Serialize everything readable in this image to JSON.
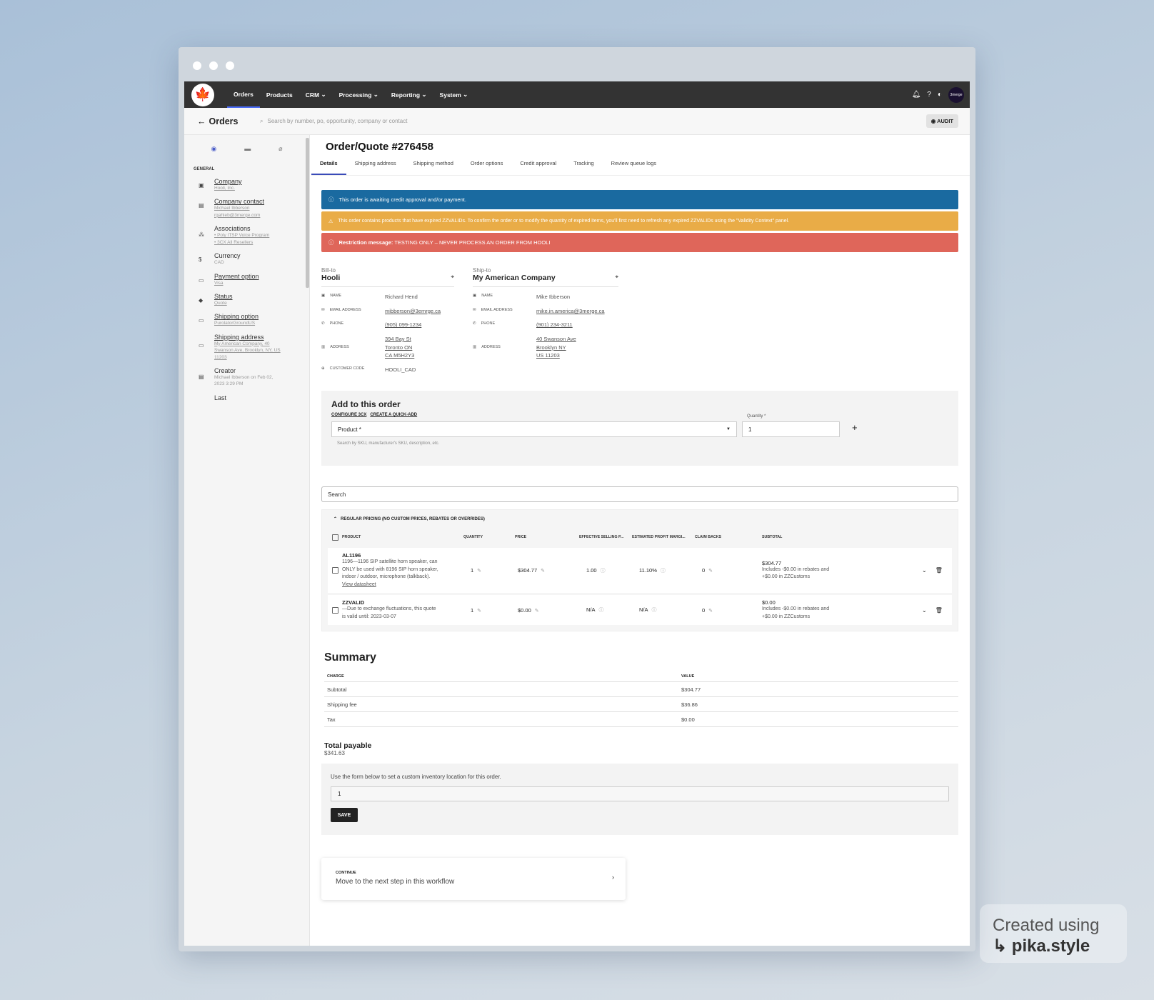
{
  "nav": {
    "items": [
      "Orders",
      "Products",
      "CRM",
      "Processing",
      "Reporting",
      "System"
    ],
    "avatar": "3merge"
  },
  "subbar": {
    "back": "Orders",
    "search_placeholder": "Search by number, po, opportunity, company or contact",
    "audit": "AUDIT"
  },
  "sidebar": {
    "heading": "GENERAL",
    "items": [
      {
        "label": "Company",
        "value": "Hooli, Inc.",
        "icon": "company-icon",
        "link": true
      },
      {
        "label": "Company contact",
        "value": "Michael Ibberson",
        "value2": "rgahleb@3merge.com",
        "icon": "contact-icon",
        "link": true
      },
      {
        "label": "Associations",
        "value": "• Poly ITSP Voice Program",
        "value2": "• 3CX All Resellers",
        "icon": "associations-icon",
        "link": false
      },
      {
        "label": "Currency",
        "value": "CAD",
        "icon": "currency-icon",
        "link": false
      },
      {
        "label": "Payment option",
        "value": "Visa",
        "icon": "payment-icon",
        "link": true
      },
      {
        "label": "Status",
        "value": "Quote",
        "icon": "status-icon",
        "link": true
      },
      {
        "label": "Shipping option",
        "value": "PurolatorGroundUS",
        "icon": "shipping-icon",
        "link": true
      },
      {
        "label": "Shipping address",
        "value": "My American Company, 40",
        "value2": "Swanson Ave, Brooklyn, NY, US",
        "value3": "11203",
        "icon": "address-icon",
        "link": true
      },
      {
        "label": "Creator",
        "value": "Michael Ibberson on Feb 02,",
        "value2": "2023 3:29 PM",
        "icon": "creator-icon",
        "link": false
      },
      {
        "label": "Last",
        "value": "",
        "icon": "",
        "link": false
      }
    ]
  },
  "main": {
    "title": "Order/Quote #276458",
    "tabs": [
      "Details",
      "Shipping address",
      "Shipping method",
      "Order options",
      "Credit approval",
      "Tracking",
      "Review queue logs"
    ],
    "alerts": {
      "info": "This order is awaiting credit approval and/or payment.",
      "warning": "This order contains products that have expired ZZVALIDs. To confirm the order or to modify the quantity of expired items, you'll first need to refresh any expired ZZVALIDs using the \"Validity Context\" panel.",
      "error_label": "Restriction message:",
      "error": "TESTING ONLY – NEVER PROCESS AN ORDER FROM HOOLI"
    },
    "bill_to": {
      "heading": "Bill-to",
      "name": "Hooli",
      "labels": {
        "name": "NAME",
        "email": "EMAIL ADDRESS",
        "phone": "PHONE",
        "address": "ADDRESS",
        "code": "CUSTOMER CODE"
      },
      "contact": "Richard Hend",
      "email": "mibberson@3emrge.ca",
      "phone": "(905) 099-1234",
      "addr1": "394 Bay St",
      "addr2": "Toronto ON",
      "addr3": "CA M5H2Y3",
      "code": "HOOLI_CAD"
    },
    "ship_to": {
      "heading": "Ship-to",
      "name": "My American Company",
      "contact": "Mike Ibberson",
      "email": "mike.in.america@3merge.ca",
      "phone": "(901) 234-3211",
      "addr1": "40 Swanson Ave",
      "addr2": "Brooklyn NY",
      "addr3": "US 11203"
    },
    "add": {
      "heading": "Add to this order",
      "link1": "CONFIGURE 3CX",
      "link2": "CREATE A QUICK-ADD",
      "product_placeholder": "Product *",
      "qty_label": "Quantity *",
      "qty_value": "1",
      "hint": "Search by SKU, manufacturer's SKU, description, etc."
    },
    "table": {
      "search": "Search",
      "group": "REGULAR PRICING (NO CUSTOM PRICES, REBATES OR OVERRIDES)",
      "headers": [
        "PRODUCT",
        "QUANTITY",
        "PRICE",
        "EFFECTIVE SELLING P...",
        "ESTIMATED PROFIT MARGI...",
        "CLAIM BACKS",
        "SUBTOTAL"
      ],
      "rows": [
        {
          "sku": "AL1196",
          "d1": "1196—1196 SIP satellite horn speaker, can",
          "d2": "ONLY be used with 8196 SIP horn speaker,",
          "d3": "indoor / outdoor, microphone (talkback).",
          "link": "View datasheet",
          "qty": "1",
          "price": "$304.77",
          "esp": "1.00",
          "margin": "11.10%",
          "claim": "0",
          "sub": "$304.77",
          "s1": "Includes -$0.00 in rebates and",
          "s2": "+$0.00 in ZZCustoms"
        },
        {
          "sku": "ZZVALID",
          "d1": "—Due to exchange fluctuations, this quote",
          "d2": "is valid until: 2023-03-07",
          "d3": "",
          "link": "",
          "qty": "1",
          "price": "$0.00",
          "esp": "N/A",
          "margin": "N/A",
          "claim": "0",
          "sub": "$0.00",
          "s1": "Includes -$0.00 in rebates and",
          "s2": "+$0.00 in ZZCustoms"
        }
      ]
    },
    "summary": {
      "heading": "Summary",
      "col_charge": "CHARGE",
      "col_value": "VALUE",
      "rows": [
        {
          "charge": "Subtotal",
          "value": "$304.77"
        },
        {
          "charge": "Shipping fee",
          "value": "$36.86"
        },
        {
          "charge": "Tax",
          "value": "$0.00"
        }
      ]
    },
    "total": {
      "label": "Total payable",
      "value": "$341.63"
    },
    "inventory": {
      "text": "Use the form below to set a custom inventory location for this order.",
      "value": "1",
      "save": "SAVE"
    },
    "continue": {
      "label": "CONTINUE",
      "text": "Move to the next step in this workflow"
    }
  },
  "badge": {
    "line1": "Created using",
    "line2": "pika.style"
  }
}
